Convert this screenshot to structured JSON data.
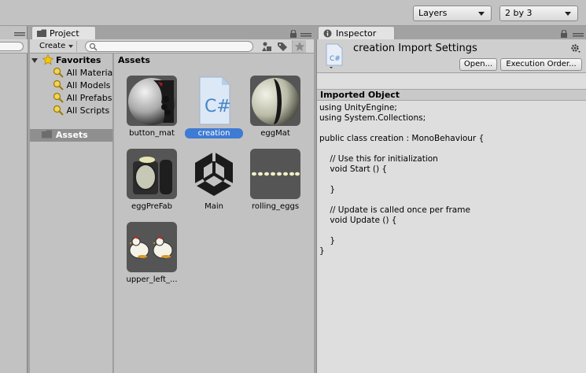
{
  "toolbar": {
    "layers_label": "Layers",
    "layout_label": "2 by 3"
  },
  "project": {
    "tab_label": "Project",
    "create_label": "Create",
    "search_placeholder": "",
    "favorites_label": "Favorites",
    "favorites": [
      "All Materia",
      "All Models",
      "All Prefabs",
      "All Scripts"
    ],
    "assets_tree_label": "Assets",
    "grid_title": "Assets",
    "items": [
      {
        "name": "button_mat",
        "icon": "sphere-material-icon",
        "selected": false
      },
      {
        "name": "creation",
        "icon": "csharp-script-icon",
        "selected": true
      },
      {
        "name": "eggMat",
        "icon": "sphere-material-icon",
        "selected": false
      },
      {
        "name": "eggPreFab",
        "icon": "prefab-icon",
        "selected": false
      },
      {
        "name": "Main",
        "icon": "unity-scene-icon",
        "selected": false
      },
      {
        "name": "rolling_eggs",
        "icon": "texture-icon",
        "selected": false
      },
      {
        "name": "upper_left_...",
        "icon": "chicken-texture-icon",
        "selected": false
      }
    ]
  },
  "inspector": {
    "tab_label": "Inspector",
    "title": "creation Import Settings",
    "open_label": "Open...",
    "exec_order_label": "Execution Order...",
    "section_label": "Imported Object",
    "code": "using UnityEngine;\nusing System.Collections;\n\npublic class creation : MonoBehaviour {\n\n    // Use this for initialization\n    void Start () {\n\n    }\n\n    // Update is called once per frame\n    void Update () {\n\n    }\n}"
  },
  "colors": {
    "selection": "#3e7bd4",
    "panel": "#c2c2c2"
  }
}
